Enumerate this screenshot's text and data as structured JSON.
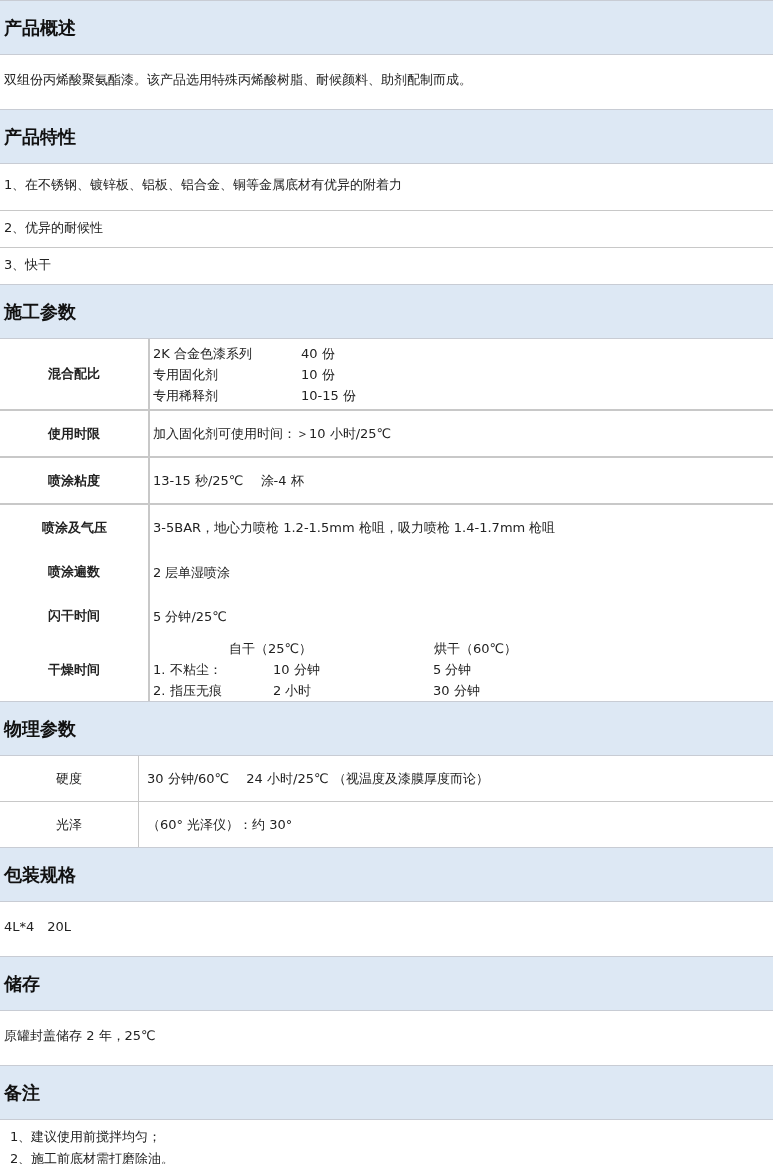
{
  "sections": [
    {
      "heading": "产品概述",
      "kind": "text",
      "lines": [
        "双组份丙烯酸聚氨酯漆。该产品选用特殊丙烯酸树脂、耐候颜料、助剂配制而成。"
      ]
    },
    {
      "heading": "产品特性",
      "kind": "rows",
      "lines": [
        "1、在不锈钢、镀锌板、铝板、铝合金、铜等金属底材有优异的附着力",
        "2、优异的耐候性",
        "3、快干"
      ]
    },
    {
      "heading": "施工参数",
      "kind": "table",
      "bold_labels": true,
      "rows": [
        {
          "label": "混合配比",
          "kind": "pairs",
          "lines": [
            [
              "2K 合金色漆系列",
              "40 份"
            ],
            [
              "专用固化剂",
              "10 份"
            ],
            [
              "专用稀释剂",
              "10-15 份"
            ]
          ]
        },
        {
          "label": "使用时限",
          "kind": "plain",
          "lines": [
            [
              "加入固化剂可使用时间：＞10 小时/25℃"
            ]
          ]
        },
        {
          "label": "喷涂粘度",
          "kind": "plain",
          "lines": [
            [
              "13-15 秒/25℃　 涂-4 杯"
            ]
          ]
        },
        {
          "label": "喷涂及气压",
          "kind": "plain",
          "lines": [
            [
              "3-5BAR，地心力喷枪 1.2-1.5mm 枪咀，吸力喷枪 1.4-1.7mm 枪咀"
            ]
          ]
        },
        {
          "label": "喷涂遍数",
          "kind": "plain",
          "joined": true,
          "lines": [
            [
              "2 层单湿喷涂"
            ]
          ]
        },
        {
          "label": "闪干时间",
          "kind": "plain",
          "joined": true,
          "lines": [
            [
              "5 分钟/25℃"
            ]
          ]
        },
        {
          "label": "干燥时间",
          "kind": "dry",
          "joined": true,
          "lines": [
            [
              "自干（25℃）",
              "烘干（60℃）"
            ],
            [
              "1. 不粘尘：",
              "10 分钟",
              "5 分钟"
            ],
            [
              "2. 指压无痕",
              "2 小时",
              "30 分钟"
            ]
          ]
        }
      ]
    },
    {
      "heading": "物理参数",
      "kind": "table",
      "bold_labels": false,
      "rows": [
        {
          "label": "硬度",
          "kind": "plain",
          "lines": [
            [
              "30 分钟/60℃　 24 小时/25℃ （视温度及漆膜厚度而论）"
            ]
          ]
        },
        {
          "label": "光泽",
          "kind": "plain",
          "lines": [
            [
              "（60° 光泽仪）：约 30°"
            ]
          ]
        }
      ]
    },
    {
      "heading": "包装规格",
      "kind": "text",
      "lines": [
        "4L*4　20L"
      ]
    },
    {
      "heading": "储存",
      "kind": "text",
      "lines": [
        "原罐封盖储存 2 年，25℃"
      ]
    },
    {
      "heading": "备注",
      "kind": "notes",
      "lines": [
        "1、建议使用前搅拌均匀；",
        "2、施工前底材需打磨除油。"
      ]
    }
  ]
}
